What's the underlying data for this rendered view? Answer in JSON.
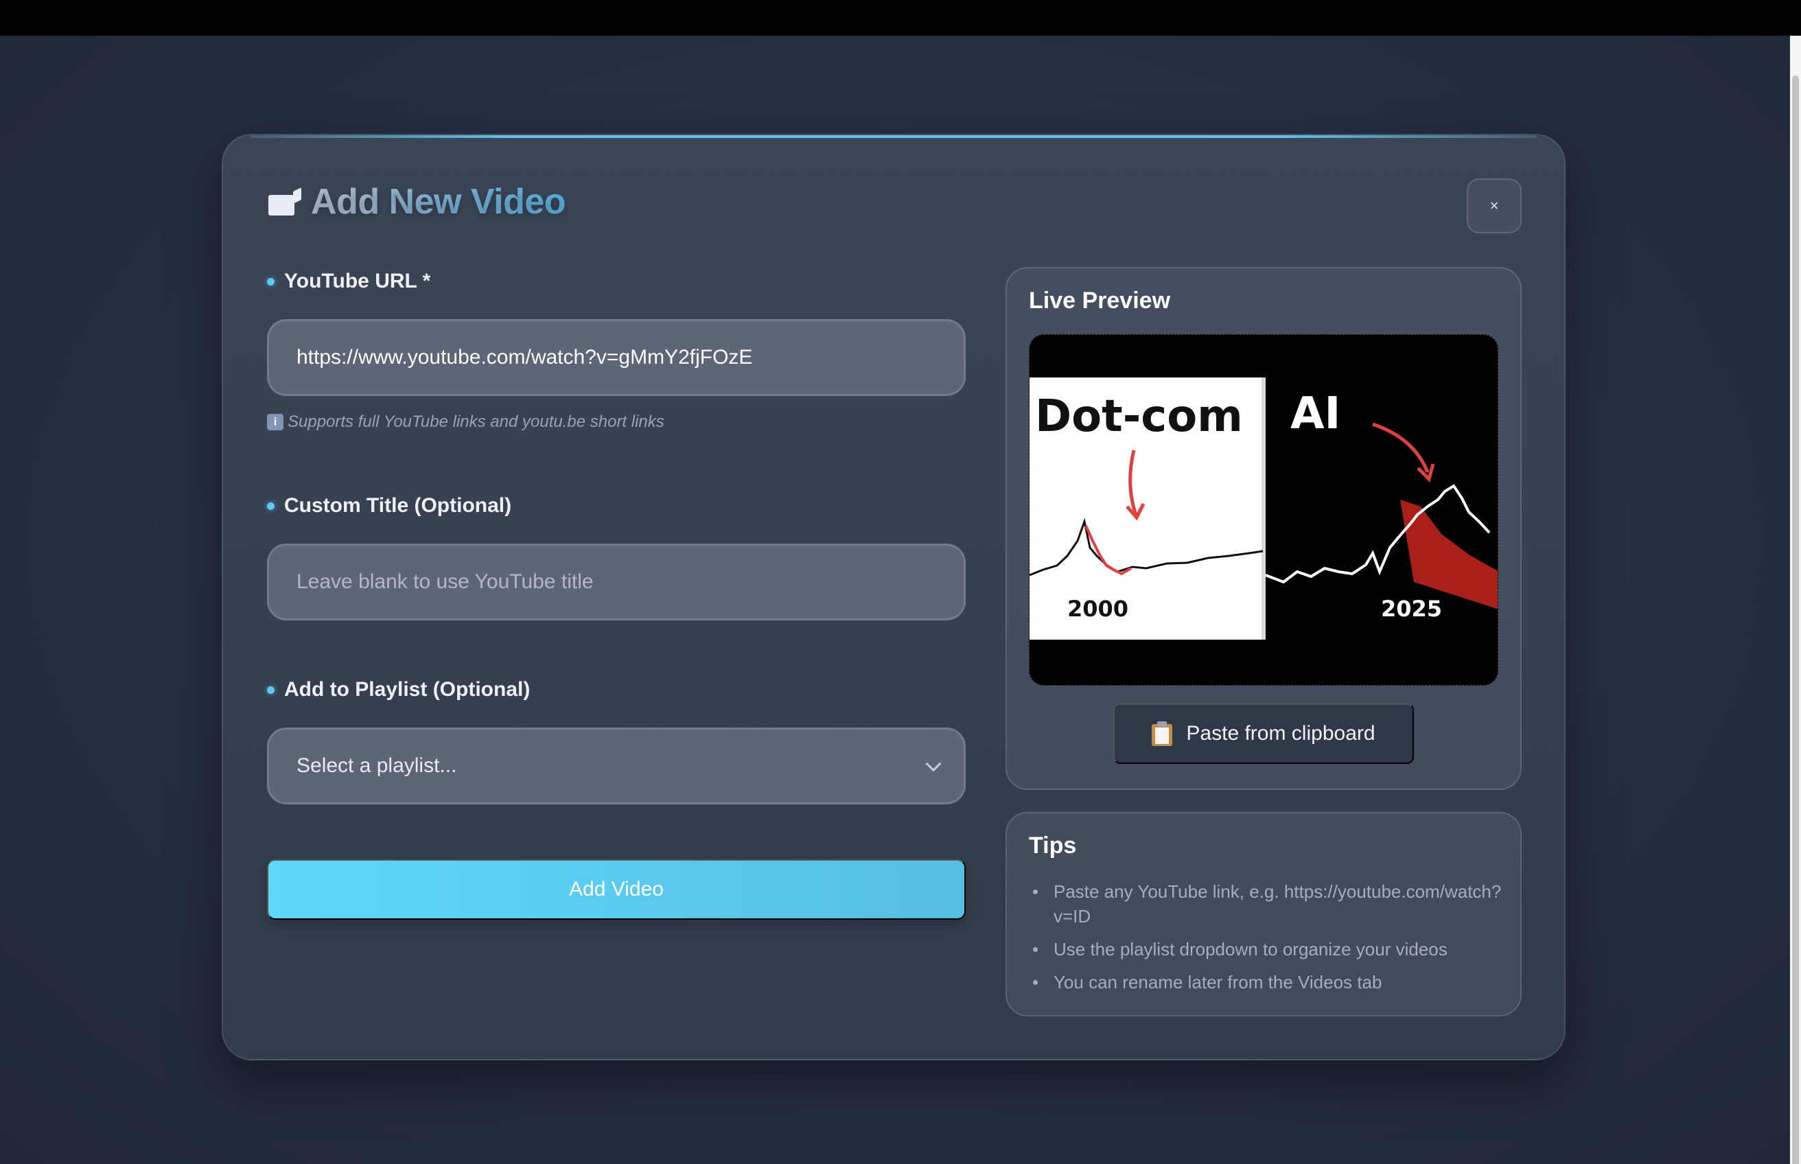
{
  "modal": {
    "title": "Add New Video",
    "close_label": "×"
  },
  "form": {
    "url": {
      "label": "YouTube URL *",
      "value": "https://www.youtube.com/watch?v=gMmY2fjFOzE",
      "hint": "Supports full YouTube links and youtu.be short links"
    },
    "custom_title": {
      "label": "Custom Title (Optional)",
      "placeholder": "Leave blank to use YouTube title"
    },
    "playlist": {
      "label": "Add to Playlist (Optional)",
      "selected": "Select a playlist..."
    },
    "submit_label": "Add Video"
  },
  "preview": {
    "title": "Live Preview",
    "thumbnail": {
      "left_text": "Dot-com",
      "left_year": "2000",
      "right_text": "AI",
      "right_year": "2025"
    },
    "paste_label": "Paste from clipboard"
  },
  "tips": {
    "title": "Tips",
    "items": [
      "Paste any YouTube link, e.g. https://youtube.com/watch?v=ID",
      "Use the playlist dropdown to organize your videos",
      "You can rename later from the Videos tab"
    ]
  },
  "colors": {
    "accent": "#5ec8f2",
    "button_gradient_start": "#5ed7fb",
    "button_gradient_end": "#55bfe4",
    "modal_bg": "#3b4556"
  }
}
